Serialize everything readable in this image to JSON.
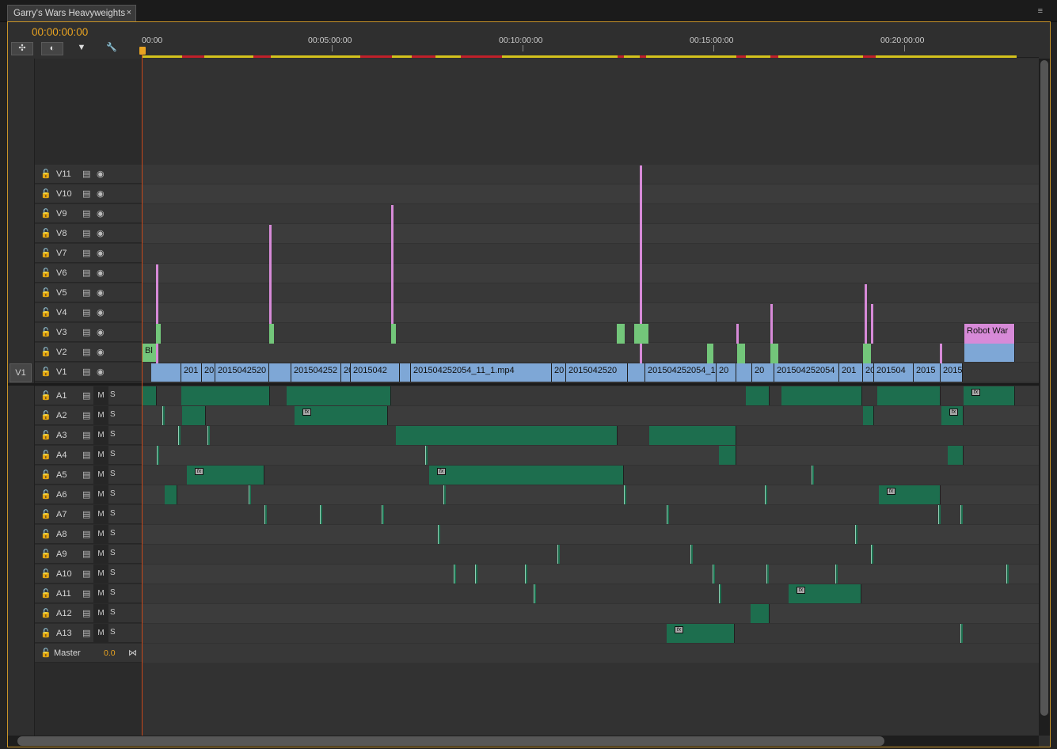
{
  "sequence": {
    "tab_title": "Garry's Wars Heavyweights",
    "close": "×",
    "timecode": "00:00:00:00",
    "panel_menu": "≡"
  },
  "toolbar": {
    "snap_icon": "snap-icon",
    "linked_icon": "linked-selection-icon",
    "marker_icon": "marker-icon",
    "settings_icon": "wrench-icon"
  },
  "ruler": {
    "ticks": [
      "00:00",
      "00:05:00:00",
      "00:10:00:00",
      "00:15:00:00",
      "00:20:00:00"
    ]
  },
  "video_tracks": [
    "V11",
    "V10",
    "V9",
    "V8",
    "V7",
    "V6",
    "V5",
    "V4",
    "V3",
    "V2",
    "V1"
  ],
  "source_patch": "V1",
  "audio_tracks": [
    "A1",
    "A2",
    "A3",
    "A4",
    "A5",
    "A6",
    "A7",
    "A8",
    "A9",
    "A10",
    "A11",
    "A12",
    "A13"
  ],
  "mute_label": "M",
  "solo_label": "S",
  "master": {
    "label": "Master",
    "volume": "0.0"
  },
  "clips": {
    "v1": [
      "201",
      "20",
      "2015042520",
      "201504252",
      "20",
      "2015042",
      "201504252054_11_1.mp4",
      "20",
      "2015042520",
      "201504252054_1",
      "20",
      "20",
      "201504252054",
      "201",
      "20",
      "201504",
      "2015",
      "2015"
    ],
    "v2": [
      "Bl"
    ],
    "v3": [
      "Robot War"
    ]
  },
  "fx_label": "fx"
}
